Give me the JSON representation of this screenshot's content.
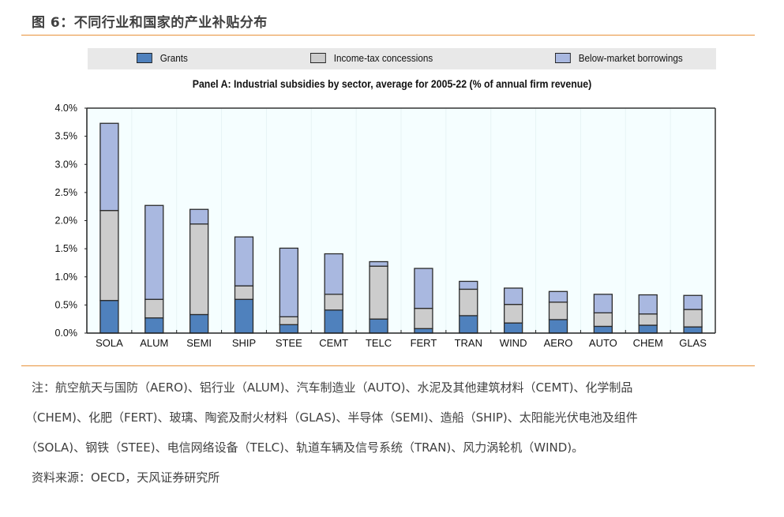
{
  "figure": {
    "title": "图 6：不同行业和国家的产业补贴分布",
    "rule_color": "#e8923a"
  },
  "legend": [
    {
      "name": "Grants",
      "color": "#4f81bd"
    },
    {
      "name": "Income-tax concessions",
      "color": "#cccccc"
    },
    {
      "name": "Below-market borrowings",
      "color": "#a9b8e0"
    }
  ],
  "chart_data": {
    "type": "bar",
    "stacked": true,
    "title": "Panel A: Industrial subsidies by sector, average for 2005-22 (% of annual firm revenue)",
    "xlabel": "",
    "ylabel": "",
    "ylim": [
      0,
      4.0
    ],
    "yticks": [
      0.0,
      0.5,
      1.0,
      1.5,
      2.0,
      2.5,
      3.0,
      3.5,
      4.0
    ],
    "ytick_labels": [
      "0.0%",
      "0.5%",
      "1.0%",
      "1.5%",
      "2.0%",
      "2.5%",
      "3.0%",
      "3.5%",
      "4.0%"
    ],
    "grid": "vertical faint",
    "legend_position": "top",
    "categories": [
      "SOLA",
      "ALUM",
      "SEMI",
      "SHIP",
      "STEE",
      "CEMT",
      "TELC",
      "FERT",
      "TRAN",
      "WIND",
      "AERO",
      "AUTO",
      "CHEM",
      "GLAS"
    ],
    "series": [
      {
        "name": "Grants",
        "color": "#4f81bd",
        "values": [
          0.58,
          0.27,
          0.33,
          0.6,
          0.15,
          0.41,
          0.25,
          0.08,
          0.31,
          0.18,
          0.24,
          0.12,
          0.14,
          0.11
        ]
      },
      {
        "name": "Income-tax concessions",
        "color": "#cccccc",
        "values": [
          1.6,
          0.33,
          1.61,
          0.24,
          0.14,
          0.28,
          0.94,
          0.36,
          0.47,
          0.33,
          0.31,
          0.24,
          0.2,
          0.31
        ]
      },
      {
        "name": "Below-market borrowings",
        "color": "#a9b8e0",
        "values": [
          1.55,
          1.67,
          0.26,
          0.87,
          1.22,
          0.72,
          0.08,
          0.71,
          0.14,
          0.29,
          0.19,
          0.33,
          0.34,
          0.25
        ]
      }
    ],
    "plot_background": "#f5feff"
  },
  "notes": {
    "line1": "注：航空航天与国防（AERO)、铝行业（ALUM)、汽车制造业（AUTO)、水泥及其他建筑材料（CEMT)、化学制品",
    "line2": "（CHEM)、化肥（FERT)、玻璃、陶瓷及耐火材料（GLAS)、半导体（SEMI)、造船（SHIP)、太阳能光伏电池及组件",
    "line3": "（SOLA)、钢铁（STEE)、电信网络设备（TELC)、轨道车辆及信号系统（TRAN)、风力涡轮机（WIND)。",
    "source": "资料来源：OECD，天风证券研究所"
  }
}
